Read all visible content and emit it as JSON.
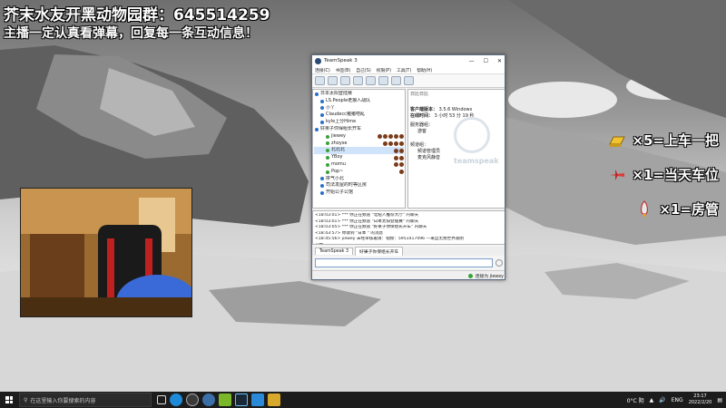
{
  "overlay": {
    "title": "芥末水友开黑动物园群：645514259",
    "subtitle": "主播一定认真看弹幕，回复每一条互动信息！",
    "rewards": [
      {
        "icon": "gold-bar-icon",
        "text": "×5=上车一把"
      },
      {
        "icon": "airplane-icon",
        "text": "×1=当天车位"
      },
      {
        "icon": "rocket-icon",
        "text": "×1=房管"
      }
    ]
  },
  "teamspeak": {
    "title": "TeamSpeak 3",
    "window_controls": [
      "—",
      "☐",
      "✕"
    ],
    "menu": [
      "连接(C)",
      "书签(B)",
      "自己(S)",
      "权限(P)",
      "工具(T)",
      "帮助(H)"
    ],
    "tree": [
      {
        "label": "日本太阳登陆赛",
        "indent": 0,
        "color": "#2a6fc9"
      },
      {
        "label": "LS.People老狼人战队",
        "indent": 1,
        "color": "#2a6fc9"
      },
      {
        "label": "小丫",
        "indent": 1,
        "color": "#2a6fc9"
      },
      {
        "label": "Claudecc猪猪吧乱",
        "indent": 1,
        "color": "#2a6fc9"
      },
      {
        "label": "kyle上分Hime",
        "indent": 1,
        "color": "#2a6fc9"
      },
      {
        "label": "好果子你保组长开车",
        "indent": 0,
        "color": "#2a6fc9"
      },
      {
        "label": "jiewey",
        "indent": 2,
        "color": "#3aa23a",
        "badges": 5
      },
      {
        "label": "zhoyse",
        "indent": 2,
        "color": "#3aa23a",
        "badges": 4
      },
      {
        "label": "北北北",
        "indent": 2,
        "color": "#3aa23a",
        "badges": 2,
        "selected": true
      },
      {
        "label": "YBoy",
        "indent": 2,
        "color": "#3aa23a",
        "badges": 2
      },
      {
        "label": "momu",
        "indent": 2,
        "color": "#3aa23a",
        "badges": 2
      },
      {
        "label": "Pop~",
        "indent": 2,
        "color": "#3aa23a",
        "badges": 1
      },
      {
        "label": "拼气小北",
        "indent": 1,
        "color": "#2a6fc9"
      },
      {
        "label": "司法发屋的时等区房",
        "indent": 1,
        "color": "#2a6fc9"
      },
      {
        "label": "开始公子公馆",
        "indent": 1,
        "color": "#2a6fc9"
      }
    ],
    "info": {
      "server_name": "日比日比",
      "client_version_label": "客户端版本：",
      "client_version": "3.5.6 Windows",
      "online_label": "在线时间：",
      "online_time": "3 小时 53 分 19 秒",
      "group_label": "服务器组：",
      "group": "游客",
      "channel_label": "频道组：",
      "channel_groups": [
        "频道管理员",
        "麦克风静音"
      ],
      "watermark": "teamspeak"
    },
    "chat": [
      "<18:03:01> *** 你正在频道 \"北纽人推荐大厅\" 内聊天",
      "<18:03:01> *** 你正在频道 \"日本太阳登陆赛\" 内聊天",
      "<18:03:05> *** 你正在频道 \"好果子你保组长开车\" 内聊天",
      "<18:43:57> 你收到 \"日本 \" 的消息",
      "<18:45:56> jiewey 未经审核邀请：视频：5951417096 —来自无畏世界观明",
      "开始"
    ],
    "tabs": [
      "TeamSpeak 3",
      "好果子你保组长开车"
    ],
    "status_right": "连接为 jiewey"
  },
  "taskbar": {
    "search_placeholder": "在这里输入你要搜索的内容",
    "weather": "0°C 阴",
    "lang": "ENG",
    "time": "23:17",
    "date": "2022/2/20"
  }
}
